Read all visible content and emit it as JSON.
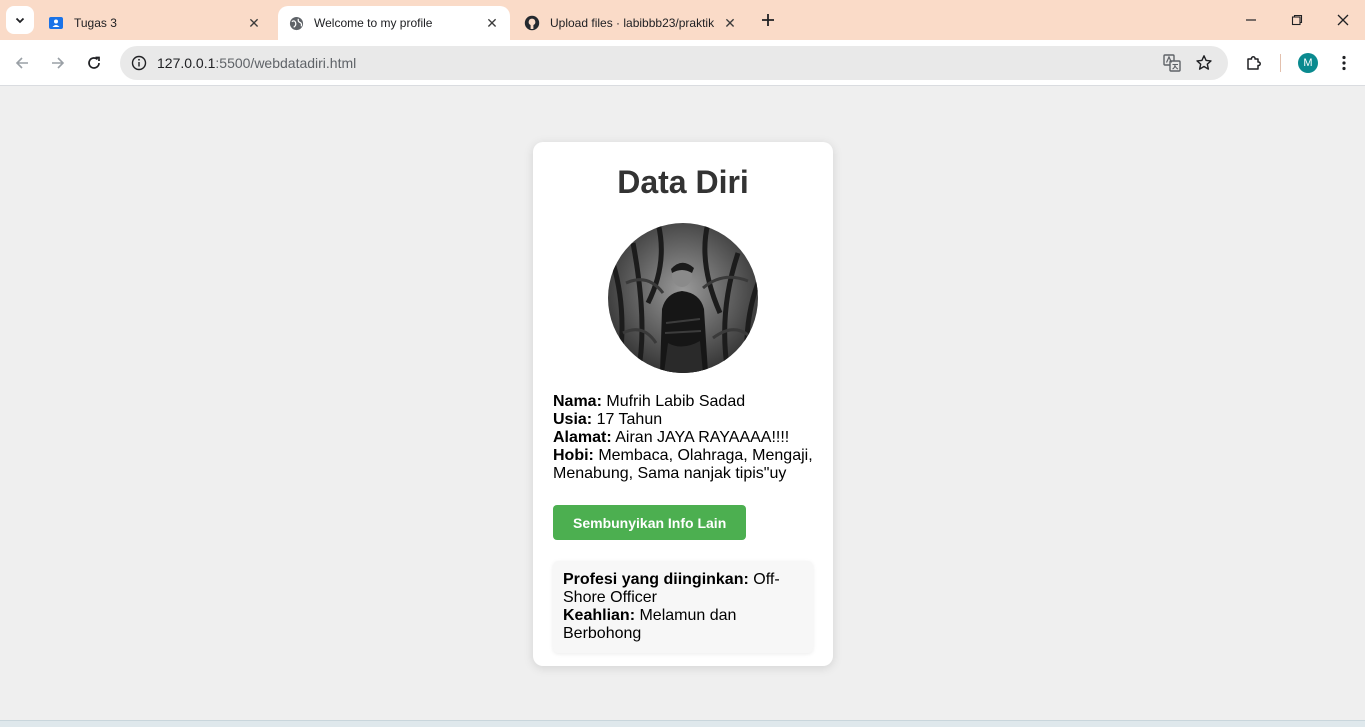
{
  "browser": {
    "tabs": [
      {
        "title": "Tugas 3",
        "icon": "classroom-icon",
        "active": false
      },
      {
        "title": "Welcome to my profile",
        "icon": "globe-icon",
        "active": true
      },
      {
        "title": "Upload files · labibbb23/praktik",
        "icon": "github-icon",
        "active": false
      }
    ],
    "address": {
      "host": "127.0.0.1",
      "path": ":5500/webdatadiri.html"
    },
    "avatar_letter": "M"
  },
  "page": {
    "heading": "Data Diri",
    "photo_alt": "profile photo",
    "fields": {
      "nama_label": "Nama:",
      "nama_value": "Mufrih Labib Sadad",
      "usia_label": "Usia:",
      "usia_value": "17 Tahun",
      "alamat_label": "Alamat:",
      "alamat_value": "Airan JAYA RAYAAAA!!!!",
      "hobi_label": "Hobi:",
      "hobi_value": "Membaca, Olahraga, Mengaji, Menabung, Sama nanjak tipis\"uy"
    },
    "toggle_button": "Sembunyikan Info Lain",
    "extra": {
      "profesi_label": "Profesi yang diinginkan:",
      "profesi_value": "Off-Shore Officer",
      "keahlian_label": "Keahlian:",
      "keahlian_value": "Melamun dan Berbohong"
    }
  },
  "colors": {
    "tabstrip": "#fadbc8",
    "button": "#4caf50",
    "page_bg": "#efefef"
  }
}
